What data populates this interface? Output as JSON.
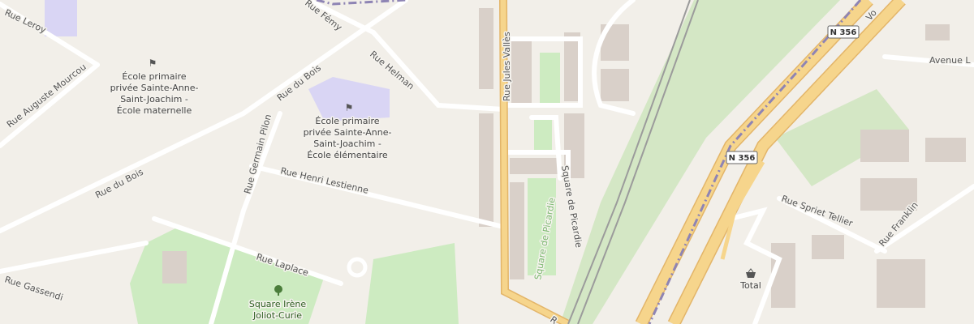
{
  "colors": {
    "background": "#f2efe9",
    "building": "#d9d0c9",
    "road_major": "#f6d58c",
    "road_major_casing": "#e3b569",
    "road_minor": "#ffffff",
    "school": "#d9d5f4",
    "park": "#cdebc1",
    "grass": "#d4e7c5",
    "railway": "#9b9b9b",
    "boundary": "#8e84b4"
  },
  "streets": {
    "rue_leroy": "Rue Leroy",
    "rue_auguste_mourcou": "Rue Auguste Mourcou",
    "rue_du_bois_1": "Rue du Bois",
    "rue_du_bois_2": "Rue du Bois",
    "rue_fremy": "Rue Fémy",
    "rue_helman": "Rue Helman",
    "rue_jules_valles": "Rue Jules Vallès",
    "rue_germain_pilon": "Rue Germain Pilon",
    "rue_henri_lestienne": "Rue Henri Lestienne",
    "rue_laplace": "Rue Laplace",
    "rue_gassendi": "Rue Gassendi",
    "square_de_picardie_1": "Square de Picardie",
    "square_de_picardie_2": "Square de Picardie",
    "avenue": "Avenue L",
    "rue_spriet_tellier": "Rue Spriet Tellier",
    "rue_franklin": "Rue Franklin",
    "vo": "Vo",
    "ri": "R"
  },
  "shields": {
    "n356_top": "N 356",
    "n356_mid": "N 356"
  },
  "pois": {
    "school_maternelle": [
      "École primaire",
      "privée Sainte-Anne-",
      "Saint-Joachim -",
      "École maternelle"
    ],
    "school_elementaire": [
      "École primaire",
      "privée Sainte-Anne-",
      "Saint-Joachim -",
      "École élémentaire"
    ],
    "square_irene": [
      "Square Irène",
      "Joliot-Curie"
    ],
    "total": "Total"
  },
  "icons": {
    "school": "school-icon",
    "park": "tree-icon",
    "fuel": "shop-basket-icon"
  }
}
